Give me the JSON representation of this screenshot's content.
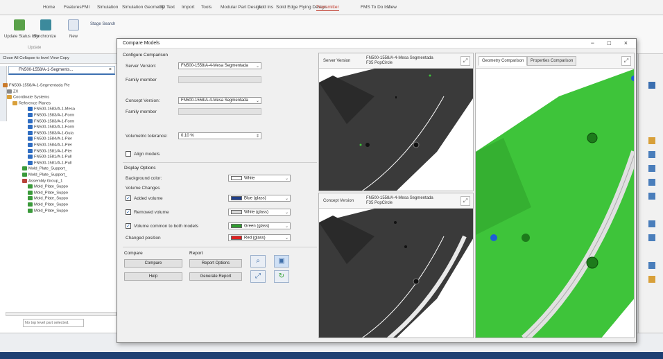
{
  "ribbon": {
    "tabs": [
      "Home",
      "Features",
      "FMI",
      "Simulation",
      "Simulation Geometry",
      "3D Text",
      "Import",
      "Tools",
      "Modular Part Design",
      "Add Ins",
      "Solid Edge Flying Design",
      "Transmitter",
      "FMS To Do list",
      "View"
    ],
    "active_tab": "Transmitter",
    "groups": [
      {
        "label": "Update Status Info"
      },
      {
        "label": "Synchronize"
      },
      {
        "label": "New"
      },
      {
        "label": "Stage Search"
      }
    ],
    "subgroup_label": "Update"
  },
  "tree": {
    "toolbar_text": "Close All  Collapse to level  View  Copy",
    "doc_tab": "FN500-1558/A-1-Segments...",
    "rows": [
      "FN500-1558/A-1-Segmentada Pie",
      "ZX",
      "Coordinate Systems",
      "Reference Planes",
      "FN500-1583/A-1-Mesa",
      "FN500-1583/A-1-Form",
      "FN500-1583/A-1-Form",
      "FN500-1583/A-1-Form",
      "FN500-1583/A-1-Guia",
      "FN500-1584/A-1-Pier",
      "FN500-1584/A-1-Pier",
      "FN500-1581/A-1-Pier",
      "FN500-1581/A-1-Pull",
      "FN500-1581/A-1-Pull",
      "Mold_Plate_Support_",
      "Mold_Plate_Support_",
      "Assembly Group_1",
      "Mold_Plate_Suppo",
      "Mold_Plate_Suppo",
      "Mold_Plate_Suppo",
      "Mold_Plate_Suppo",
      "Mold_Plate_Suppo"
    ],
    "status": "No top level part selected."
  },
  "dialog": {
    "title": "Compare Models",
    "configure_heading": "Configure Comparison",
    "server_version_label": "Server Version:",
    "server_version_value": "FN500-1558/A-4-Mesa Segmentada",
    "family_member_label": "Family member",
    "concept_version_label": "Concept Version:",
    "concept_version_value": "FN500-1558/A-4-Mesa Segmentada",
    "family_member_label2": "Family member",
    "tolerance_label": "Volumetric tolerance:",
    "tolerance_value": "0.10 %",
    "align_label": "Align models",
    "display_heading": "Display Options",
    "bg_color_label": "Background color:",
    "bg_color_value": "White",
    "volume_changes_label": "Volume Changes",
    "added_label": "Added volume",
    "added_value": "Blue (glass)",
    "removed_label": "Removed volume",
    "removed_value": "White (glass)",
    "common_label": "Volume common to both models",
    "common_value": "Green (glass)",
    "changed_label": "Changed position",
    "changed_value": "Red (glass)",
    "compare_group": "Compare",
    "report_group": "Report",
    "compare_button": "Compare",
    "help_button": "Help",
    "report_options_button": "Report Options",
    "generate_report_button": "Generate Report",
    "server_panel_label": "Server Version",
    "server_panel_value": "FN500-1558/A-4-Mesa Segmentada F35 PopCircle",
    "concept_panel_label": "Concept Version",
    "concept_panel_value": "FN500-1558/A-4-Mesa Segmentada F35 PopCircle",
    "tab_geometry": "Geometry Comparison",
    "tab_properties": "Properties Comparison"
  },
  "colors": {
    "accent": "#c0392b",
    "blue_glass": "#1f3f8a",
    "white_glass": "#d9d9d9",
    "green_glass": "#2e9e2e",
    "red_glass": "#e02020",
    "model_dark": "#3a3a3a",
    "model_green": "#3ec43a"
  }
}
